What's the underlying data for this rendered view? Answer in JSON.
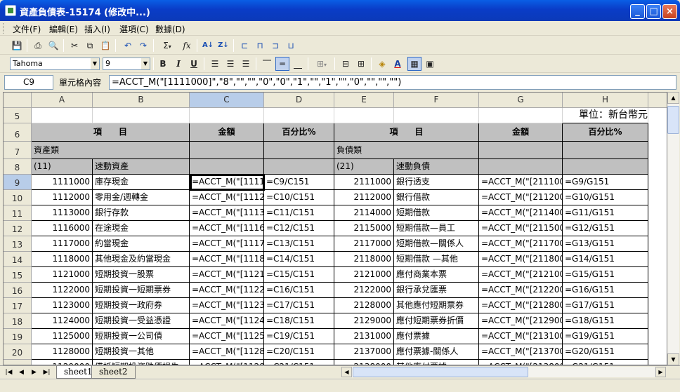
{
  "window": {
    "title": "資產負債表-15174 (修改中...)",
    "controls": [
      "_",
      "□",
      "×"
    ]
  },
  "menu": [
    {
      "label": "文件(F)"
    },
    {
      "label": "編輯(E)"
    },
    {
      "label": "插入(I)"
    },
    {
      "label": "選項(C)"
    },
    {
      "label": "數據(D)"
    }
  ],
  "toolbar": {
    "font_name": "Tahoma",
    "font_size": "9",
    "bold": "B",
    "italic": "I",
    "underline": "U",
    "sigma": "Σ",
    "fx": "fx"
  },
  "formula_bar": {
    "name_box": "C9",
    "label": "單元格內容",
    "content": "=ACCT_M(\"[1111000]\",\"8\",\"\",\"\",\"0\",\"0\",\"1\",\"\",\"1\",\"\",\"0\",\"\",\"\",\"\")"
  },
  "columns": [
    "A",
    "B",
    "C",
    "D",
    "E",
    "F",
    "G",
    "H"
  ],
  "rows": {
    "r5": {
      "num": "5",
      "H": "單位：新台幣元"
    },
    "r6": {
      "num": "6",
      "AB": "項　　目",
      "C": "金額",
      "D": "百分比%",
      "EF": "項　　目",
      "G": "金額",
      "H": "百分比%"
    },
    "r7": {
      "num": "7",
      "AB": "資產類",
      "EF": "負債類"
    },
    "r8": {
      "num": "8",
      "A": "(11)",
      "B": "速動資產",
      "E": "(21)",
      "F": "速動負債"
    },
    "data": [
      {
        "num": "9",
        "A": "1111000",
        "B": "庫存現金",
        "C": "=ACCT_M(\"[1111",
        "D": "=C9/C151",
        "E": "2111000",
        "F": "銀行透支",
        "G": "=ACCT_M(\"[211100",
        "H": "=G9/G151"
      },
      {
        "num": "10",
        "A": "1112000",
        "B": "零用金/週轉金",
        "C": "=ACCT_M(\"[1112",
        "D": "=C10/C151",
        "E": "2112000",
        "F": "銀行借款",
        "G": "=ACCT_M(\"[211200",
        "H": "=G10/G151"
      },
      {
        "num": "11",
        "A": "1113000",
        "B": "銀行存款",
        "C": "=ACCT_M(\"[1113",
        "D": "=C11/C151",
        "E": "2114000",
        "F": "短期借款",
        "G": "=ACCT_M(\"[211400",
        "H": "=G11/G151"
      },
      {
        "num": "12",
        "A": "1116000",
        "B": "在途現金",
        "C": "=ACCT_M(\"[1116",
        "D": "=C12/C151",
        "E": "2115000",
        "F": "短期借款—員工",
        "G": "=ACCT_M(\"[211500",
        "H": "=G12/G151"
      },
      {
        "num": "13",
        "A": "1117000",
        "B": "約當現金",
        "C": "=ACCT_M(\"[1117",
        "D": "=C13/C151",
        "E": "2117000",
        "F": "短期借款—關係人",
        "G": "=ACCT_M(\"[211700",
        "H": "=G13/G151"
      },
      {
        "num": "14",
        "A": "1118000",
        "B": "其他現金及約當現金",
        "C": "=ACCT_M(\"[1118",
        "D": "=C14/C151",
        "E": "2118000",
        "F": "短期借款 —其他",
        "G": "=ACCT_M(\"[211800",
        "H": "=G14/G151"
      },
      {
        "num": "15",
        "A": "1121000",
        "B": "短期投資一股票",
        "C": "=ACCT_M(\"[1121",
        "D": "=C15/C151",
        "E": "2121000",
        "F": "應付商業本票",
        "G": "=ACCT_M(\"[212100",
        "H": "=G15/G151"
      },
      {
        "num": "16",
        "A": "1122000",
        "B": "短期投資一短期票券",
        "C": "=ACCT_M(\"[1122",
        "D": "=C16/C151",
        "E": "2122000",
        "F": "銀行承兌匯票",
        "G": "=ACCT_M(\"[212200",
        "H": "=G16/G151"
      },
      {
        "num": "17",
        "A": "1123000",
        "B": "短期投資一政府券",
        "C": "=ACCT_M(\"[1123",
        "D": "=C17/C151",
        "E": "2128000",
        "F": "其他應付短期票券",
        "G": "=ACCT_M(\"[212800",
        "H": "=G17/G151"
      },
      {
        "num": "18",
        "A": "1124000",
        "B": "短期投資一受益憑證",
        "C": "=ACCT_M(\"[1124",
        "D": "=C18/C151",
        "E": "2129000",
        "F": "應付短期票券折價",
        "G": "=ACCT_M(\"[212900",
        "H": "=G18/G151"
      },
      {
        "num": "19",
        "A": "1125000",
        "B": "短期投資一公司債",
        "C": "=ACCT_M(\"[1125",
        "D": "=C19/C151",
        "E": "2131000",
        "F": "應付票據",
        "G": "=ACCT_M(\"[213100",
        "H": "=G19/G151"
      },
      {
        "num": "20",
        "A": "1128000",
        "B": "短期投資一其他",
        "C": "=ACCT_M(\"[1128",
        "D": "=C20/C151",
        "E": "2137000",
        "F": "應付票據-關係人",
        "G": "=ACCT_M(\"[213700",
        "H": "=G20/G151"
      },
      {
        "num": "21",
        "A": "1129000",
        "B": "備抵短期投資跌價損失",
        "C": "=ACCT_M(\"[1129",
        "D": "=C21/C151",
        "E": "2138000",
        "F": "其他應付票據",
        "G": "=ACCT_M(\"[213800",
        "H": "=G21/G151"
      }
    ]
  },
  "sheets": [
    {
      "label": "sheet1",
      "active": true
    },
    {
      "label": "sheet2",
      "active": false
    }
  ]
}
